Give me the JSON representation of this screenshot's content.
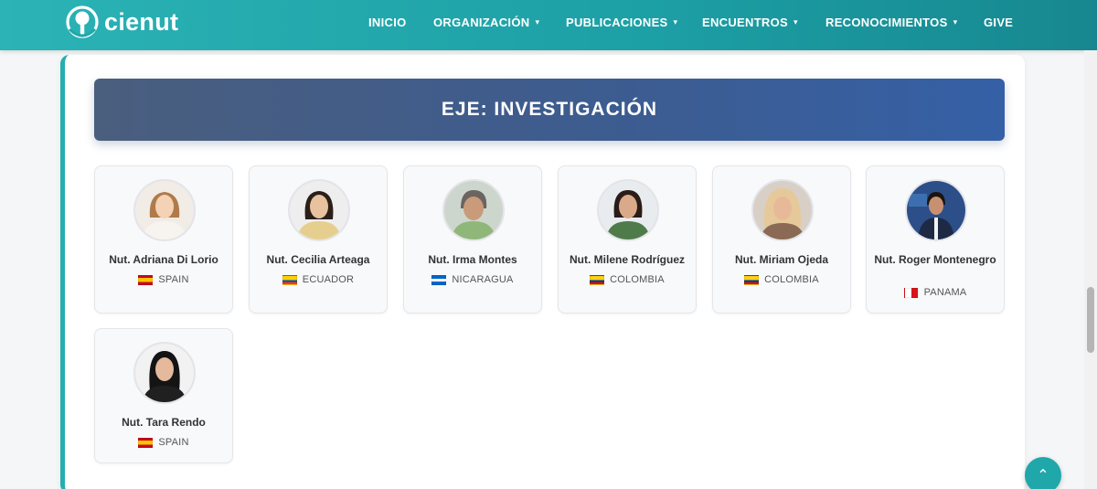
{
  "brand": {
    "name": "cienut"
  },
  "nav": {
    "items": [
      {
        "label": "INICIO",
        "caret": false
      },
      {
        "label": "ORGANIZACIÓN",
        "caret": true
      },
      {
        "label": "PUBLICACIONES",
        "caret": true
      },
      {
        "label": "ENCUENTROS",
        "caret": true
      },
      {
        "label": "RECONOCIMIENTOS",
        "caret": true
      },
      {
        "label": "GIVE",
        "caret": false
      }
    ],
    "caret_glyph": "▾"
  },
  "section": {
    "title": "EJE: INVESTIGACIÓN"
  },
  "members": [
    {
      "name": "Nut. Adriana Di Lorio",
      "country": "SPAIN",
      "flag": "spain-flag-icon"
    },
    {
      "name": "Nut. Cecilia Arteaga",
      "country": "ECUADOR",
      "flag": "ecuador-flag-icon"
    },
    {
      "name": "Nut. Irma Montes",
      "country": "NICARAGUA",
      "flag": "nicaragua-flag-icon"
    },
    {
      "name": "Nut. Milene Rodríguez",
      "country": "COLOMBIA",
      "flag": "colombia-flag-icon"
    },
    {
      "name": "Nut. Miriam Ojeda",
      "country": "COLOMBIA",
      "flag": "colombia-flag-icon"
    },
    {
      "name": "Nut. Roger Montenegro",
      "country": "PANAMA",
      "flag": "panama-flag-icon"
    },
    {
      "name": "Nut. Tara Rendo",
      "country": "SPAIN",
      "flag": "spain-flag-icon"
    }
  ],
  "back_to_top": {
    "glyph": "⌃"
  },
  "colors": {
    "nav": "#1fa7aa",
    "accent": "#25aeb0",
    "banner": "#3d5c8f"
  }
}
